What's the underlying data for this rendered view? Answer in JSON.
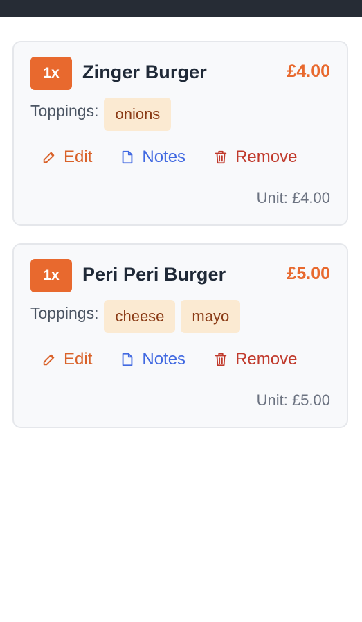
{
  "cart": {
    "items": [
      {
        "qty": "1x",
        "name": "Zinger Burger",
        "price": "£4.00",
        "toppings_label": "Toppings:",
        "toppings": [
          "onions"
        ],
        "actions": {
          "edit": "Edit",
          "notes": "Notes",
          "remove": "Remove"
        },
        "unit_price": "Unit: £4.00"
      },
      {
        "qty": "1x",
        "name": "Peri Peri Burger",
        "price": "£5.00",
        "toppings_label": "Toppings:",
        "toppings": [
          "cheese",
          "mayo"
        ],
        "actions": {
          "edit": "Edit",
          "notes": "Notes",
          "remove": "Remove"
        },
        "unit_price": "Unit: £5.00"
      }
    ]
  },
  "colors": {
    "accent": "#e8692e",
    "notes": "#4169e1",
    "danger": "#c0392b",
    "chip_bg": "#fbead2",
    "topbar": "#262c35"
  },
  "icons": {
    "edit": "pencil-icon",
    "notes": "document-icon",
    "remove": "trash-icon"
  }
}
